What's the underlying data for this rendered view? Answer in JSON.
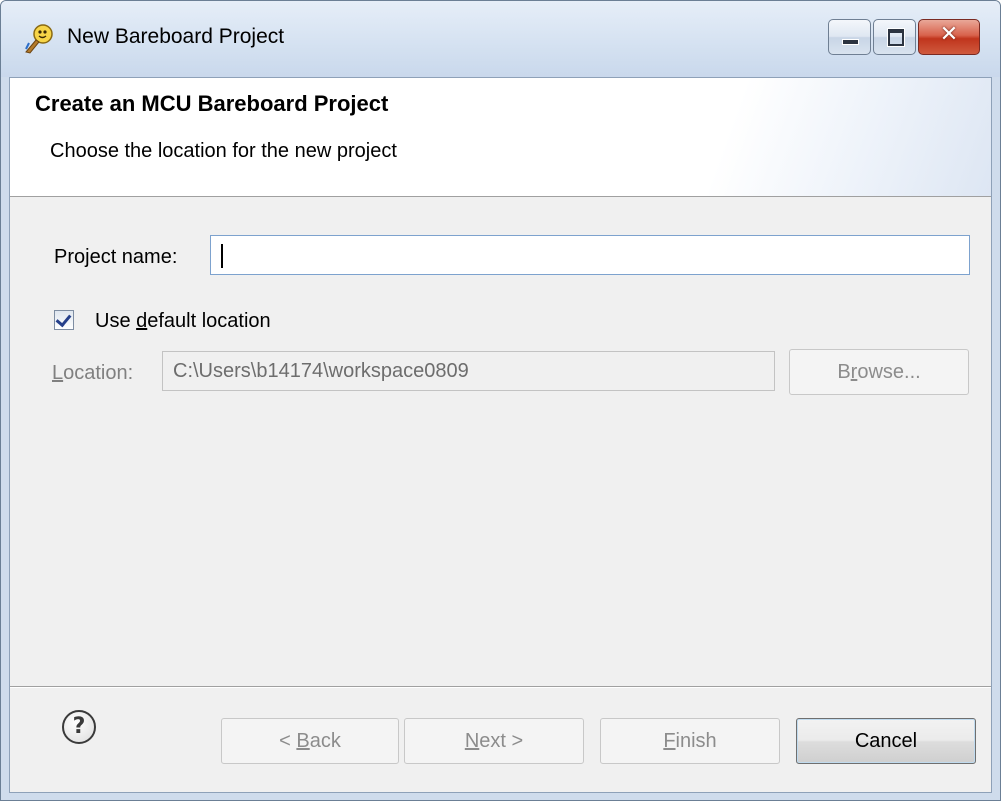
{
  "window": {
    "title": "New Bareboard Project",
    "close_glyph": "✕",
    "icon": "eclipse-wizard-icon"
  },
  "banner": {
    "title": "Create an MCU Bareboard Project",
    "description": "Choose the location for the new project"
  },
  "form": {
    "project_name_label": "Project name:",
    "project_name_value": "",
    "use_default_checked": true,
    "use_default_pre": "Use ",
    "use_default_mnemonic": "d",
    "use_default_post": "efault location",
    "location_label_mnemonic": "L",
    "location_label_rest": "ocation:",
    "location_value": "C:\\Users\\b14174\\workspace0809",
    "browse_pre": "B",
    "browse_mnemonic": "r",
    "browse_post": "owse..."
  },
  "footer": {
    "help_glyph": "?",
    "back_pre": "< ",
    "back_mnemonic": "B",
    "back_post": "ack",
    "next_mnemonic": "N",
    "next_post": "ext >",
    "finish_mnemonic": "F",
    "finish_post": "inish",
    "cancel_label": "Cancel"
  },
  "colors": {
    "titlebar": "#d4e1f1",
    "dialog_bg": "#f0f0f0",
    "close_button": "#c0351d",
    "disabled_text": "#808080"
  }
}
